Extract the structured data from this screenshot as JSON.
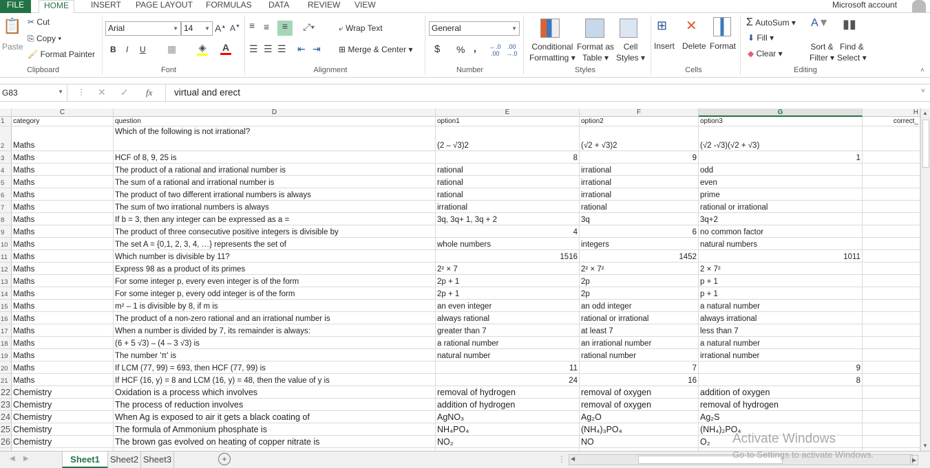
{
  "ribbon_tabs": [
    "FILE",
    "HOME",
    "INSERT",
    "PAGE LAYOUT",
    "FORMULAS",
    "DATA",
    "REVIEW",
    "VIEW"
  ],
  "account": "Microsoft account",
  "clipboard": {
    "paste": "Paste",
    "cut": "Cut",
    "copy": "Copy",
    "format_painter": "Format Painter",
    "label": "Clipboard"
  },
  "font": {
    "name": "Arial",
    "size": "14",
    "bold": "B",
    "italic": "I",
    "underline": "U",
    "label": "Font",
    "fill_color": "#ffff00",
    "font_color": "#ff0000"
  },
  "alignment": {
    "wrap_text": "Wrap Text",
    "merge_center": "Merge & Center",
    "label": "Alignment"
  },
  "number": {
    "format": "General",
    "currency": "$",
    "percent": "%",
    "comma": ",",
    "label": "Number"
  },
  "styles": {
    "conditional": "Conditional",
    "formatting": "Formatting",
    "format_as": "Format as",
    "table": "Table",
    "cell": "Cell",
    "cell_styles": "Styles",
    "label": "Styles"
  },
  "cells": {
    "insert": "Insert",
    "delete": "Delete",
    "format": "Format",
    "label": "Cells"
  },
  "editing": {
    "autosum": "AutoSum",
    "fill": "Fill",
    "clear": "Clear",
    "sort": "Sort &",
    "filter": "Filter",
    "find": "Find &",
    "select": "Select",
    "label": "Editing"
  },
  "formula_bar": {
    "name_box": "G83",
    "fx": "fx",
    "value": "virtual and erect"
  },
  "columns": [
    "C",
    "D",
    "E",
    "F",
    "G",
    "H"
  ],
  "selected_column": "G",
  "rows": [
    {
      "n": "1",
      "c": "category",
      "d": "question",
      "e": "option1",
      "f": "option2",
      "g": "option3",
      "h": "correct_"
    },
    {
      "n": "2",
      "c": "Maths",
      "d": "Which of the following is not irrational?",
      "e": "(2 – √3)2",
      "f": "(√2 + √3)2",
      "g": "(√2 -√3)(√2 + √3)"
    },
    {
      "n": "3",
      "c": "Maths",
      "d": "HCF of 8, 9, 25 is",
      "e": "8",
      "f": "9",
      "g": "1"
    },
    {
      "n": "4",
      "c": "Maths",
      "d": "The product of a rational and irrational number is",
      "e": "rational",
      "f": "irrational",
      "g": "odd"
    },
    {
      "n": "5",
      "c": "Maths",
      "d": " The sum of a rational and irrational number is",
      "e": "rational",
      "f": "irrational",
      "g": "even"
    },
    {
      "n": "6",
      "c": "Maths",
      "d": "The product of two different irrational numbers is always",
      "e": "rational",
      "f": "irrational",
      "g": "prime"
    },
    {
      "n": "7",
      "c": "Maths",
      "d": "The sum of two irrational numbers is always",
      "e": "irrational",
      "f": "rational",
      "g": "rational or irrational"
    },
    {
      "n": "8",
      "c": "Maths",
      "d": "If b = 3, then any integer can be expressed as a =",
      "e": "3q, 3q+ 1, 3q + 2",
      "f": " 3q",
      "g": "3q+2"
    },
    {
      "n": "9",
      "c": "Maths",
      "d": "The product of three consecutive positive integers is divisible by",
      "e": "4",
      "f": "6",
      "g": "no common factor"
    },
    {
      "n": "10",
      "c": "Maths",
      "d": "The set A = {0,1, 2, 3, 4, …} represents the set of",
      "e": "whole numbers",
      "f": "integers",
      "g": "natural numbers"
    },
    {
      "n": "11",
      "c": "Maths",
      "d": "Which number is divisible by 11?",
      "e": "1516",
      "f": "1452",
      "g": "1011"
    },
    {
      "n": "12",
      "c": "Maths",
      "d": "Express 98 as a product of its primes",
      "e": "2² × 7",
      "f": " 2² × 7²",
      "g": "2 × 7²"
    },
    {
      "n": "13",
      "c": "Maths",
      "d": " For some integer p, every even integer is of the form",
      "e": "2p + 1",
      "f": "2p",
      "g": "p + 1"
    },
    {
      "n": "14",
      "c": "Maths",
      "d": " For some integer p, every odd integer is of the form",
      "e": "2p + 1",
      "f": "2p",
      "g": " p + 1"
    },
    {
      "n": "15",
      "c": "Maths",
      "d": " m² – 1 is divisible by 8, if m is",
      "e": "an even integer",
      "f": "an odd integer",
      "g": "a natural number"
    },
    {
      "n": "16",
      "c": "Maths",
      "d": "The product of a non-zero rational and an irrational number is",
      "e": "always rational",
      "f": "rational or irrational",
      "g": "always irrational"
    },
    {
      "n": "17",
      "c": "Maths",
      "d": " When a number is divided by 7, its remainder is always:",
      "e": "greater than 7",
      "f": "at least 7",
      "g": "less than 7"
    },
    {
      "n": "18",
      "c": "Maths",
      "d": "(6 + 5 √3) – (4 – 3 √3) is",
      "e": "a rational number",
      "f": "an irrational number",
      "g": "a natural number"
    },
    {
      "n": "19",
      "c": "Maths",
      "d": " The number 'π' is",
      "e": "natural number",
      "f": "rational number",
      "g": "irrational number"
    },
    {
      "n": "20",
      "c": "Maths",
      "d": "If LCM (77, 99) = 693, then HCF (77, 99) is",
      "e": "11",
      "f": "7",
      "g": "9"
    },
    {
      "n": "21",
      "c": "Maths",
      "d": " If HCF (16, y) = 8 and LCM (16, y) = 48, then the value of y is",
      "e": "24",
      "f": "16",
      "g": "8"
    },
    {
      "n": "22",
      "c": "Chemistry",
      "d": "Oxidation is a process which involves",
      "e": "removal of hydrogen",
      "f": "removal of oxygen",
      "g": "addition of oxygen"
    },
    {
      "n": "23",
      "c": "Chemistry",
      "d": "The process of reduction involves",
      "e": "addition of hydrogen",
      "f": "removal of oxygen",
      "g": "removal of hydrogen"
    },
    {
      "n": "24",
      "c": "Chemistry",
      "d": "When Ag is exposed to air it gets a black coating of",
      "e": "AgNO₃",
      "f": "Ag₂O",
      "g": "Ag₂S"
    },
    {
      "n": "25",
      "c": "Chemistry",
      "d": "The formula of Ammonium phosphate is",
      "e": "NH₄PO₄",
      "f": "(NH₄)₃PO₄",
      "g": "(NH₄)₂PO₄"
    },
    {
      "n": "26",
      "c": "Chemistry",
      "d": "The brown gas evolved on heating of copper nitrate is",
      "e": "NO₂",
      "f": "NO",
      "g": "O₂"
    }
  ],
  "sheets": [
    "Sheet1",
    "Sheet2",
    "Sheet3"
  ],
  "active_sheet": "Sheet1",
  "watermark": {
    "title": "Activate Windows",
    "subtitle": "Go to Settings to activate Windows."
  },
  "accent_color": "#217346"
}
